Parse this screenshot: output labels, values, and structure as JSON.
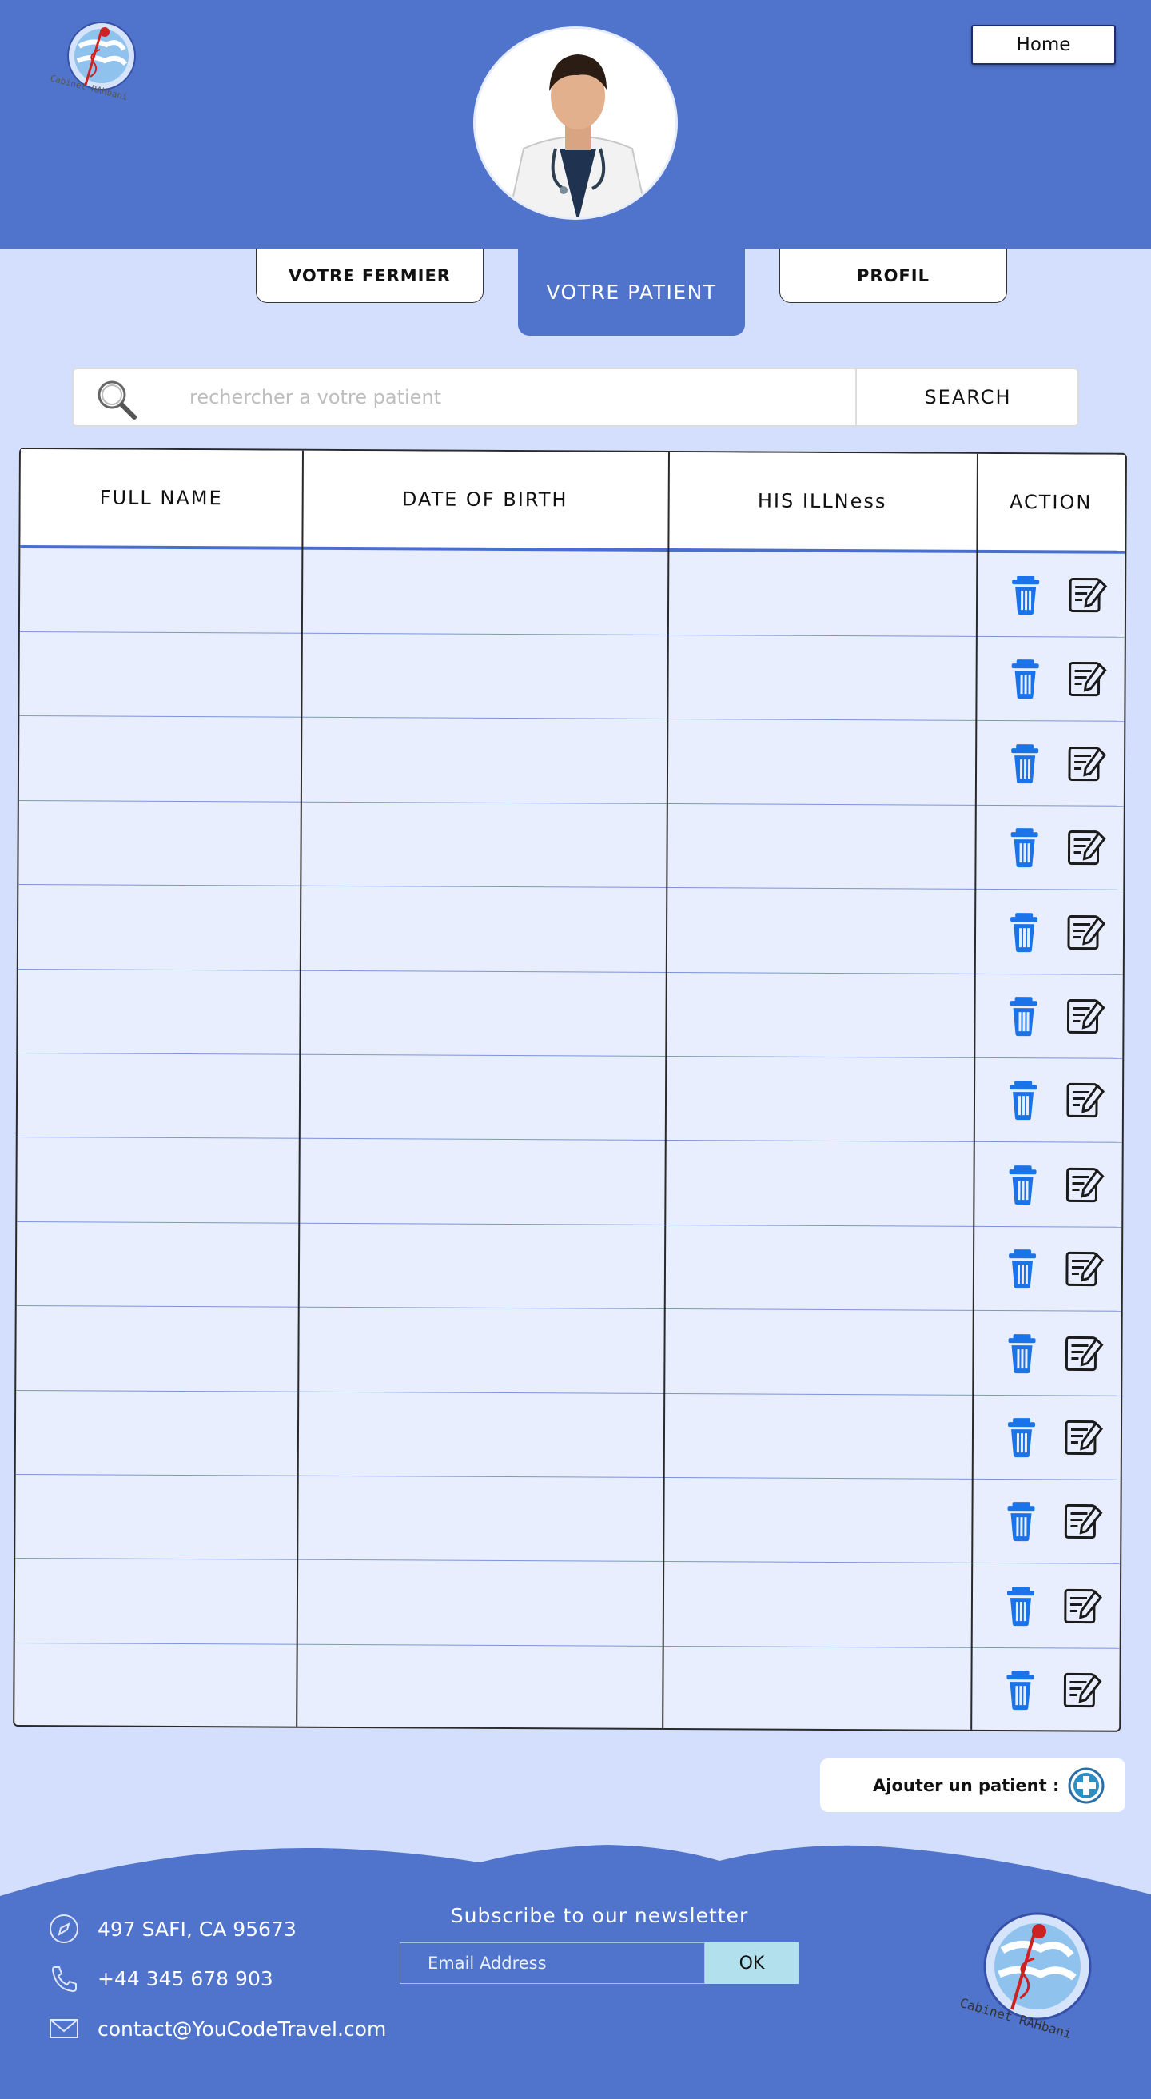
{
  "header": {
    "logo_text": "Cabinet RAHbani",
    "home_label": "Home"
  },
  "tabs": {
    "left": "VOTRE FERMIER",
    "active": "VOTRE PATIENT",
    "right": "PROFIL"
  },
  "search": {
    "placeholder": "rechercher a votre patient",
    "button_label": "SEARCH"
  },
  "table": {
    "columns": [
      "FULL NAME",
      "DATE OF BIRTH",
      "HIS ILLNess",
      "ACTION"
    ],
    "row_count": 14,
    "row_icons": [
      "trash-icon",
      "edit-icon"
    ]
  },
  "add_patient": {
    "label": "Ajouter un patient :"
  },
  "footer": {
    "address": "497  SAFI, CA 95673",
    "phone": "+44 345 678 903",
    "email": "contact@YouCodeTravel.com",
    "newsletter_title": "Subscribe to our newsletter",
    "email_placeholder": "Email Address",
    "ok_label": "OK",
    "logo_text": "Cabinet RAHbani"
  },
  "colors": {
    "primary": "#5074cb",
    "background": "#d3dffd",
    "row_bg": "#e8eefd",
    "icon_blue": "#1a73e8",
    "ok_button": "#b2e0ec"
  }
}
